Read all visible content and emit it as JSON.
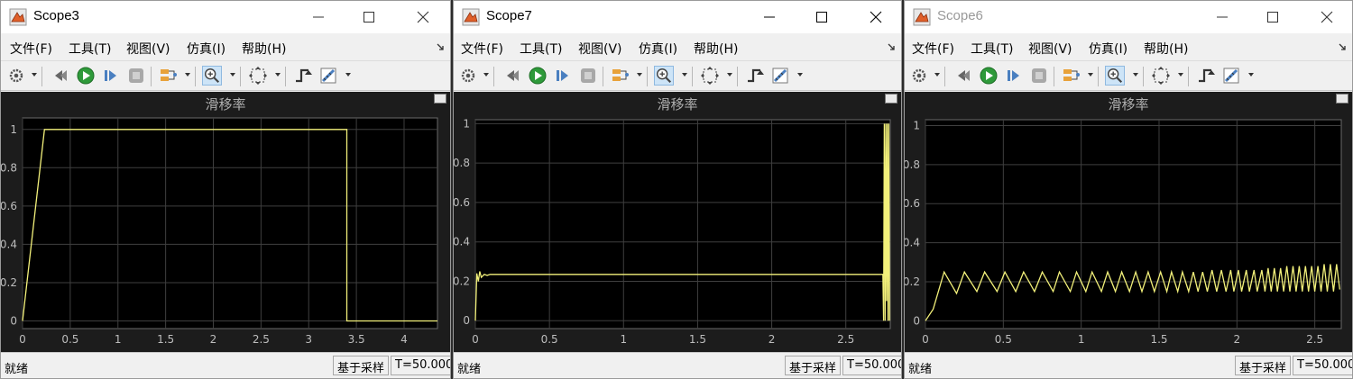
{
  "menu": [
    "文件(F)",
    "工具(T)",
    "视图(V)",
    "仿真(I)",
    "帮助(H)"
  ],
  "status": {
    "ready": "就绪",
    "sampling": "基于采样",
    "time": "T=50.000"
  },
  "colors": {
    "trace": "#f2f07a",
    "plot_bg": "#1c1c1c",
    "axes_bg": "#000000",
    "grid": "#3f3f3f"
  },
  "windows": [
    {
      "title": "Scope3",
      "state": "inactive",
      "plot_title": "滑移率"
    },
    {
      "title": "Scope7",
      "state": "active",
      "plot_title": "滑移率"
    },
    {
      "title": "Scope6",
      "state": "inactive",
      "plot_title": "滑移率"
    }
  ],
  "chart_data": [
    {
      "type": "line",
      "title": "滑移率",
      "grid": true,
      "xlim": [
        0,
        4.35
      ],
      "ylim": [
        -0.04,
        1.06
      ],
      "xticks": [
        "0",
        "0.5",
        "1",
        "1.5",
        "2",
        "2.5",
        "3",
        "3.5",
        "4"
      ],
      "yticks": [
        "0",
        "0.2",
        "0.4",
        "0.6",
        "0.8",
        "1"
      ],
      "series": [
        {
          "x": [
            0,
            0.23,
            3.4,
            3.4,
            4.35
          ],
          "y": [
            0,
            1,
            1,
            0,
            0
          ]
        }
      ]
    },
    {
      "type": "line",
      "title": "滑移率",
      "grid": true,
      "xlim": [
        0,
        2.8
      ],
      "ylim": [
        -0.04,
        1.02
      ],
      "xticks": [
        "0",
        "0.5",
        "1",
        "1.5",
        "2",
        "2.5"
      ],
      "yticks": [
        "0",
        "0.2",
        "0.4",
        "0.6",
        "0.8",
        "1"
      ],
      "series": [
        {
          "x": [
            0,
            0.01,
            0.02,
            0.03,
            0.04,
            0.06,
            0.08,
            0.1,
            2.75,
            2.755,
            2.76,
            2.765,
            2.77,
            2.775,
            2.78,
            2.785,
            2.79,
            2.795
          ],
          "y": [
            0,
            0.24,
            0.2,
            0.25,
            0.22,
            0.235,
            0.23,
            0.235,
            0.235,
            0,
            1,
            0,
            1,
            0.1,
            1,
            0,
            1,
            0
          ]
        }
      ]
    },
    {
      "type": "line",
      "title": "滑移率",
      "grid": true,
      "xlim": [
        0,
        2.67
      ],
      "ylim": [
        -0.04,
        1.03
      ],
      "xticks": [
        "0",
        "0.5",
        "1",
        "1.5",
        "2",
        "2.5"
      ],
      "yticks": [
        "0",
        "0.2",
        "0.4",
        "0.6",
        "0.8",
        "1"
      ],
      "series": [
        {
          "x": [
            0,
            0.05,
            0.12,
            0.2,
            0.25,
            0.33,
            0.38,
            0.46,
            0.51,
            0.58,
            0.63,
            0.7,
            0.75,
            0.82,
            0.86,
            0.93,
            0.97,
            1.03,
            1.07,
            1.13,
            1.17,
            1.22,
            1.26,
            1.31,
            1.35,
            1.39,
            1.43,
            1.47,
            1.51,
            1.55,
            1.58,
            1.62,
            1.65,
            1.69,
            1.72,
            1.75,
            1.78,
            1.81,
            1.84,
            1.87,
            1.9,
            1.93,
            1.96,
            1.98,
            2.01,
            2.03,
            2.06,
            2.08,
            2.11,
            2.13,
            2.16,
            2.18,
            2.2,
            2.22,
            2.24,
            2.26,
            2.28,
            2.3,
            2.32,
            2.34,
            2.36,
            2.38,
            2.4,
            2.42,
            2.44,
            2.46,
            2.48,
            2.5,
            2.52,
            2.54,
            2.56,
            2.58,
            2.6,
            2.62,
            2.64,
            2.66
          ],
          "y": [
            0,
            0.06,
            0.25,
            0.14,
            0.25,
            0.15,
            0.25,
            0.15,
            0.25,
            0.15,
            0.25,
            0.15,
            0.25,
            0.15,
            0.25,
            0.15,
            0.25,
            0.15,
            0.25,
            0.15,
            0.25,
            0.15,
            0.25,
            0.15,
            0.25,
            0.15,
            0.25,
            0.15,
            0.25,
            0.15,
            0.25,
            0.15,
            0.25,
            0.15,
            0.25,
            0.15,
            0.25,
            0.15,
            0.26,
            0.15,
            0.26,
            0.15,
            0.26,
            0.15,
            0.26,
            0.15,
            0.26,
            0.15,
            0.26,
            0.15,
            0.26,
            0.15,
            0.27,
            0.15,
            0.27,
            0.15,
            0.27,
            0.15,
            0.28,
            0.15,
            0.28,
            0.15,
            0.28,
            0.15,
            0.28,
            0.15,
            0.28,
            0.15,
            0.28,
            0.15,
            0.29,
            0.15,
            0.29,
            0.15,
            0.29,
            0.16
          ]
        }
      ]
    }
  ]
}
